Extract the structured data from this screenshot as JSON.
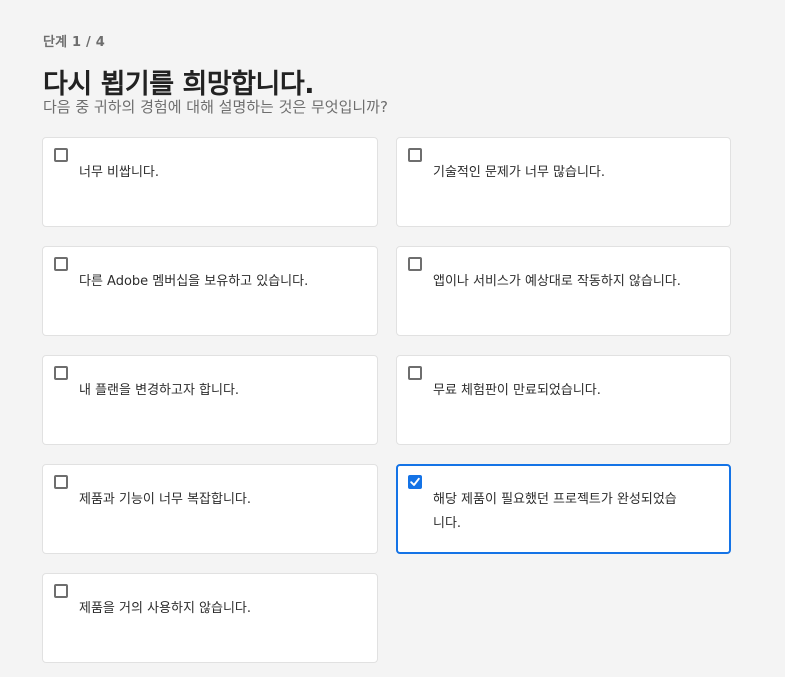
{
  "step_label": "단계 1 / 4",
  "title": "다시 뵙기를 희망합니다.",
  "subtitle": "다음 중 귀하의 경험에 대해 설명하는 것은 무엇입니까?",
  "options": [
    {
      "label": "너무 비쌉니다.",
      "checked": false
    },
    {
      "label": "기술적인 문제가 너무 많습니다.",
      "checked": false
    },
    {
      "label": "다른 Adobe 멤버십을 보유하고 있습니다.",
      "checked": false
    },
    {
      "label": "앱이나 서비스가 예상대로 작동하지 않습니다.",
      "checked": false
    },
    {
      "label": "내 플랜을 변경하고자 합니다.",
      "checked": false
    },
    {
      "label": "무료 체험판이 만료되었습니다.",
      "checked": false
    },
    {
      "label": "제품과 기능이 너무 복잡합니다.",
      "checked": false
    },
    {
      "label": "해당 제품이 필요했던 프로젝트가 완성되었습니다.",
      "checked": true
    },
    {
      "label": "제품을 거의 사용하지 않습니다.",
      "checked": false
    }
  ],
  "colors": {
    "accent": "#1473e6",
    "background": "#f4f4f4",
    "card": "#ffffff"
  }
}
